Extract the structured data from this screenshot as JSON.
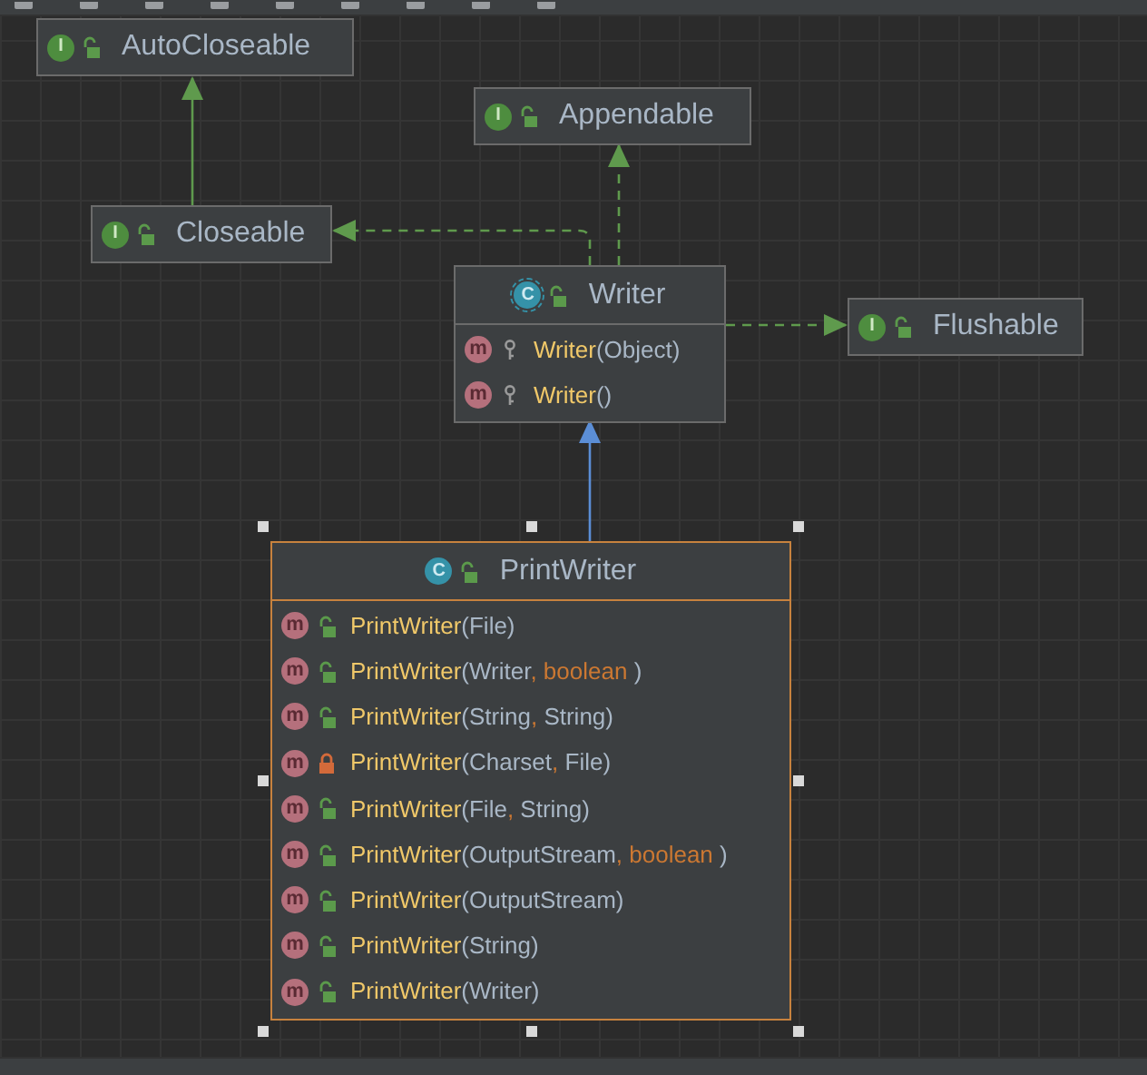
{
  "nodes": [
    {
      "kind": "interface",
      "badge": "I",
      "name": "AutoCloseable",
      "selected": false
    },
    {
      "kind": "interface",
      "badge": "I",
      "name": "Appendable",
      "selected": false
    },
    {
      "kind": "interface",
      "badge": "I",
      "name": "Closeable",
      "selected": false
    },
    {
      "kind": "abstract",
      "badge": "C",
      "name": "Writer",
      "selected": false,
      "methods": [
        {
          "badge": "m",
          "kind": "protected",
          "name": "Writer",
          "parts": [
            {
              "text": "(Object)",
              "keyword": false
            }
          ]
        },
        {
          "badge": "m",
          "kind": "protected",
          "name": "Writer",
          "parts": [
            {
              "text": "()",
              "keyword": false
            }
          ]
        }
      ]
    },
    {
      "kind": "interface",
      "badge": "I",
      "name": "Flushable",
      "selected": false
    },
    {
      "kind": "class",
      "badge": "C",
      "name": "PrintWriter",
      "selected": true,
      "methods": [
        {
          "badge": "m",
          "kind": "public",
          "name": "PrintWriter",
          "parts": [
            {
              "text": "(File)",
              "keyword": false
            }
          ]
        },
        {
          "badge": "m",
          "kind": "public",
          "name": "PrintWriter",
          "parts": [
            {
              "text": "(Writer",
              "keyword": false
            },
            {
              "text": ", boolean ",
              "keyword": true
            },
            {
              "text": ")",
              "keyword": false
            }
          ]
        },
        {
          "badge": "m",
          "kind": "public",
          "name": "PrintWriter",
          "parts": [
            {
              "text": "(String",
              "keyword": false
            },
            {
              "text": ",",
              "keyword": true
            },
            {
              "text": " String)",
              "keyword": false
            }
          ]
        },
        {
          "badge": "m",
          "kind": "private",
          "name": "PrintWriter",
          "parts": [
            {
              "text": "(Charset",
              "keyword": false
            },
            {
              "text": ",",
              "keyword": true
            },
            {
              "text": " File)",
              "keyword": false
            }
          ]
        },
        {
          "badge": "m",
          "kind": "public",
          "name": "PrintWriter",
          "parts": [
            {
              "text": "(File",
              "keyword": false
            },
            {
              "text": ",",
              "keyword": true
            },
            {
              "text": " String)",
              "keyword": false
            }
          ]
        },
        {
          "badge": "m",
          "kind": "public",
          "name": "PrintWriter",
          "parts": [
            {
              "text": "(OutputStream",
              "keyword": false
            },
            {
              "text": ", boolean ",
              "keyword": true
            },
            {
              "text": ")",
              "keyword": false
            }
          ]
        },
        {
          "badge": "m",
          "kind": "public",
          "name": "PrintWriter",
          "parts": [
            {
              "text": "(OutputStream)",
              "keyword": false
            }
          ]
        },
        {
          "badge": "m",
          "kind": "public",
          "name": "PrintWriter",
          "parts": [
            {
              "text": "(String)",
              "keyword": false
            }
          ]
        },
        {
          "badge": "m",
          "kind": "public",
          "name": "PrintWriter",
          "parts": [
            {
              "text": "(Writer)",
              "keyword": false
            }
          ]
        }
      ]
    }
  ],
  "edges": [
    {
      "kind": "extends"
    },
    {
      "kind": "implements"
    },
    {
      "kind": "implements"
    },
    {
      "kind": "implements"
    },
    {
      "kind": "class_extends"
    }
  ]
}
